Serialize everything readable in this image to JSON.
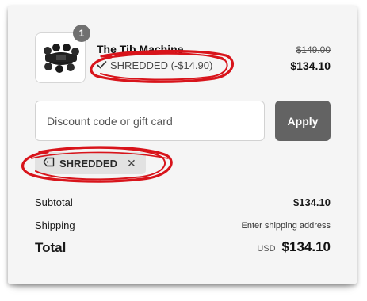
{
  "line_item": {
    "quantity": "1",
    "name": "The Tib Machine",
    "discount_text": "SHREDDED (-$14.90)",
    "compare_price": "$149.00",
    "price": "$134.10"
  },
  "discount_form": {
    "placeholder": "Discount code or gift card",
    "apply_label": "Apply"
  },
  "applied_code": {
    "label": "SHREDDED",
    "remove_symbol": "✕"
  },
  "summary": {
    "subtotal_label": "Subtotal",
    "subtotal_value": "$134.10",
    "shipping_label": "Shipping",
    "shipping_value": "Enter shipping address",
    "total_label": "Total",
    "currency": "USD",
    "total_value": "$134.10"
  },
  "icons": {
    "check": "check-icon",
    "tag": "tag-icon",
    "close": "close-icon"
  },
  "colors": {
    "annotation_red": "#d8141b",
    "button_bg": "#636363",
    "chip_bg": "#e2e2e2"
  }
}
